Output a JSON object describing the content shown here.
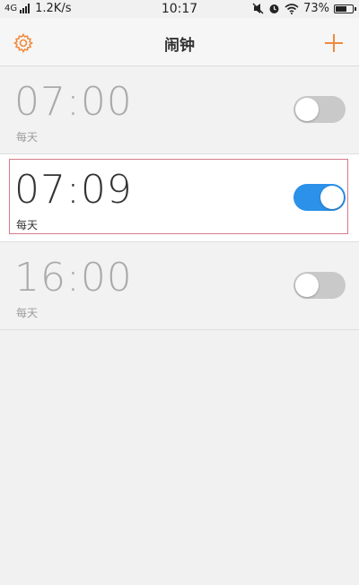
{
  "status_bar": {
    "network": "4G",
    "speed": "1.2K/s",
    "time": "10:17",
    "battery": "73%",
    "battery_level": 0.73
  },
  "header": {
    "title": "闹钟"
  },
  "alarms": [
    {
      "time": "07:00",
      "repeat": "每天",
      "enabled": false
    },
    {
      "time": "07:09",
      "repeat": "每天",
      "enabled": true
    },
    {
      "time": "16:00",
      "repeat": "每天",
      "enabled": false
    }
  ],
  "colors": {
    "accent": "#f08a3c",
    "toggle_on": "#2b91e9",
    "toggle_off": "#c9c9c9"
  },
  "icons": {
    "settings": "gear-icon",
    "add": "plus-icon",
    "mute": "mute-icon",
    "alarm": "alarm-clock-icon",
    "wifi": "wifi-icon",
    "battery": "battery-icon"
  }
}
